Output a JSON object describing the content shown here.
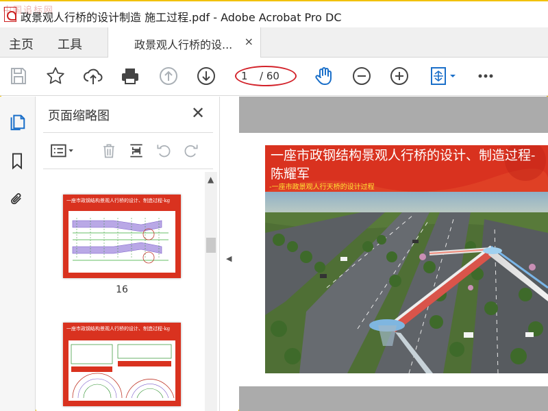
{
  "window": {
    "title": "政景观人行桥的设计制造 施工过程.pdf - Adobe Acrobat Pro DC",
    "watermark": "中国追标网"
  },
  "tabs": {
    "home": "主页",
    "tools": "工具",
    "document": "政景观人行桥的设...",
    "document_close": "×"
  },
  "toolbar": {
    "current_page": "1",
    "total_pages": "/ 60",
    "icons": [
      "save-icon",
      "star-icon",
      "cloud-upload-icon",
      "print-icon",
      "page-up-icon",
      "page-down-icon",
      "hand-tool-icon",
      "zoom-out-icon",
      "zoom-in-icon",
      "fit-page-icon",
      "more-icon"
    ],
    "accent_color": "#1a6fc9",
    "highlight_color": "#d3222a"
  },
  "sidebar": {
    "icons": [
      "page-thumbnails-icon",
      "bookmark-icon",
      "attachment-icon"
    ]
  },
  "thumbnail_panel": {
    "title": "页面缩略图",
    "close": "✕",
    "tools": [
      "thumbnail-options-icon",
      "delete-icon",
      "insert-page-icon",
      "rotate-left-icon",
      "rotate-right-icon"
    ],
    "thumbnails": [
      {
        "page_number": "16",
        "header": "一座市政钢结构景观人行桥的设计、制造过程-kg"
      },
      {
        "page_number": "",
        "header": "一座市政钢结构景观人行桥的设计、制造过程-kg"
      }
    ]
  },
  "document": {
    "slide_title_line1": "一座市政钢结构景观人行桥的设计、制造过程-",
    "slide_title_line2": "陈耀军",
    "slide_subtitle": "-一座市政景观人行天桥的设计过程"
  }
}
